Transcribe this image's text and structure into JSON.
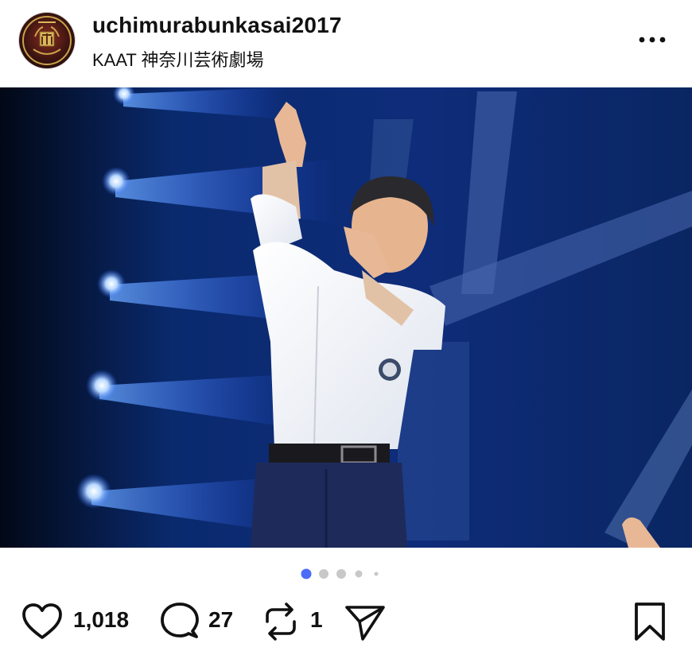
{
  "post": {
    "username": "uchimurabunkasai2017",
    "location": "KAAT 神奈川芸術劇場"
  },
  "carousel": {
    "total": 5,
    "active_index": 0,
    "active_color": "#4a6cf7",
    "inactive_color": "#c8c8c8"
  },
  "actions": {
    "likes": "1,018",
    "comments": "27",
    "reposts": "1"
  },
  "icons": {
    "avatar": "school-crest-avatar",
    "more": "more-dots-icon",
    "like": "heart-icon",
    "comment": "comment-bubble-icon",
    "repost": "repost-icon",
    "share": "share-paper-plane-icon",
    "save": "bookmark-icon"
  }
}
